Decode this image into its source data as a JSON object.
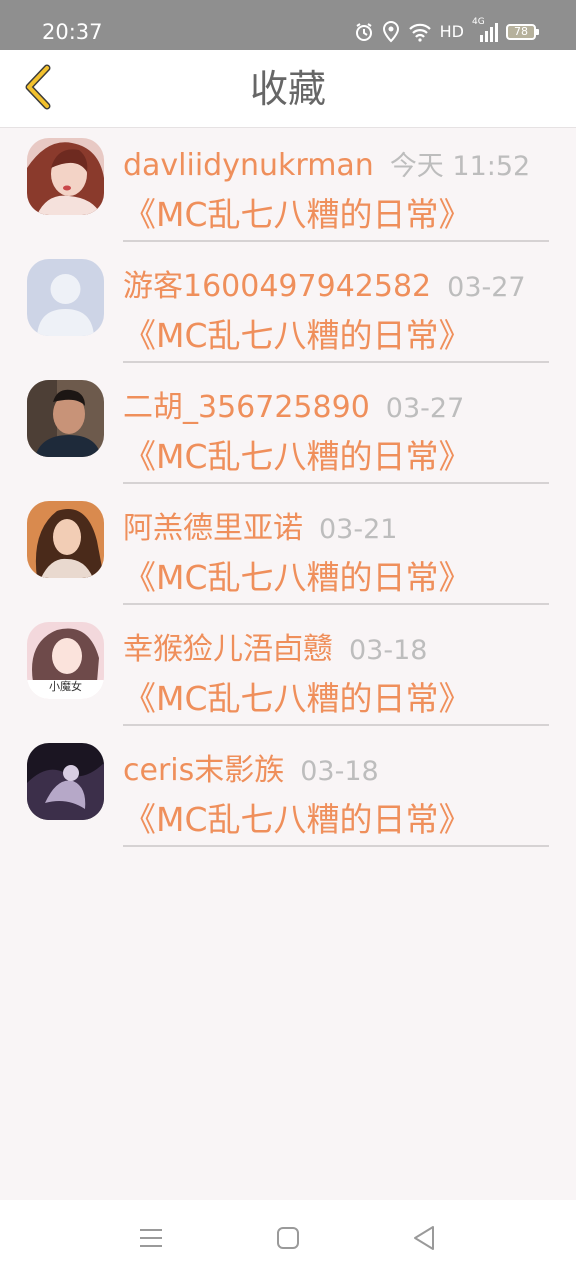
{
  "status_bar": {
    "time": "20:37",
    "network_label": "HD",
    "signal_label": "4G",
    "battery_level": "78",
    "icons": [
      "alarm-icon",
      "location-icon",
      "wifi-icon",
      "signal-icon",
      "battery-icon"
    ]
  },
  "header": {
    "title": "收藏",
    "back_icon": "chevron-left-icon",
    "accent_color": "#f2c12e"
  },
  "favorites": [
    {
      "username": "davliidynukrman",
      "time": "今天 11:52",
      "book": "《MC乱七八糟的日常》"
    },
    {
      "username": "游客1600497942582",
      "time": "03-27",
      "book": "《MC乱七八糟的日常》"
    },
    {
      "username": "二胡_356725890",
      "time": "03-27",
      "book": "《MC乱七八糟的日常》"
    },
    {
      "username": "阿羔德里亚诺",
      "time": "03-21",
      "book": "《MC乱七八糟的日常》"
    },
    {
      "username": "幸猴猃儿浯卣戆",
      "time": "03-18",
      "book": "《MC乱七八糟的日常》",
      "avatar_caption": "小魔女"
    },
    {
      "username": "ceris末影族",
      "time": "03-18",
      "book": "《MC乱七八糟的日常》"
    }
  ],
  "colors": {
    "username": "#ef8f5b",
    "time": "#bdbdbd",
    "status_bar": "#8f8f8f",
    "background": "#f9f5f6"
  },
  "nav_bar": {
    "icons": [
      "menu-icon",
      "home-square-icon",
      "back-triangle-icon"
    ]
  }
}
